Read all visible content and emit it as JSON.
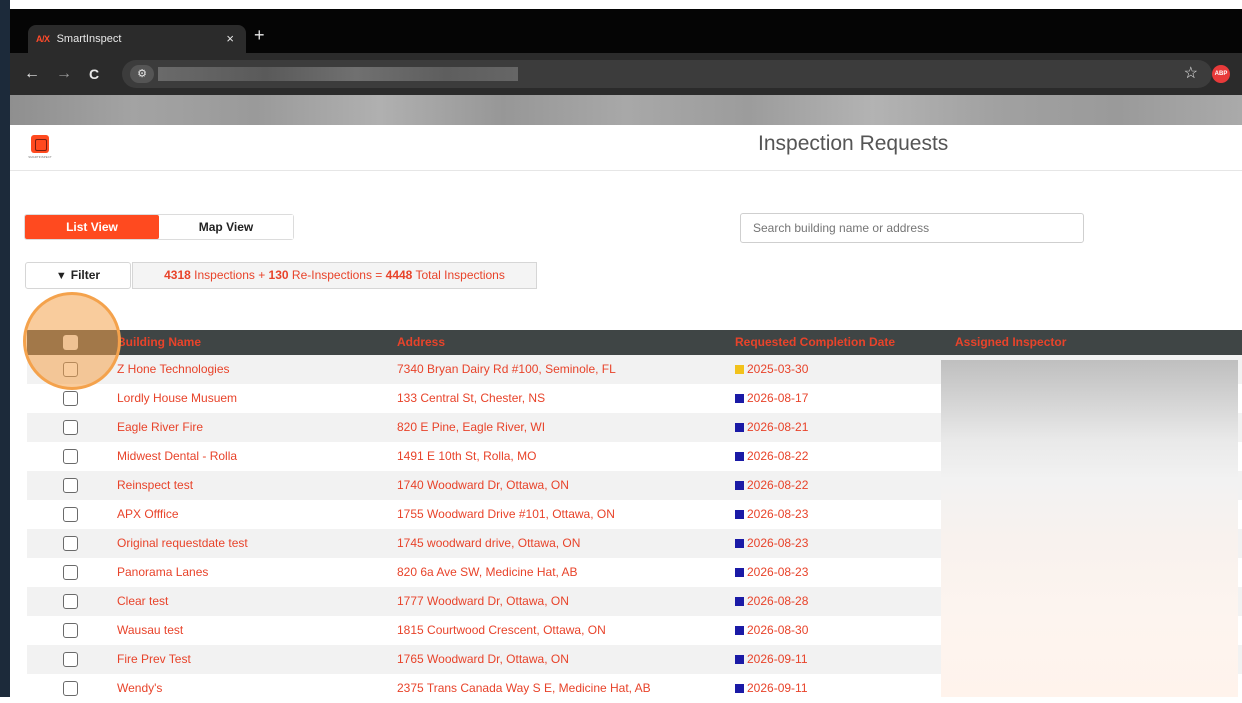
{
  "browser": {
    "tab_logo": "A/X",
    "tab_title": "SmartInspect",
    "tab_close": "×",
    "new_tab": "+",
    "back_icon": "←",
    "forward_icon": "→",
    "reload_icon": "C",
    "site_icon": "⚙",
    "bookmark_star": "☆",
    "extension_label": "ABP"
  },
  "header": {
    "title": "Inspection Requests",
    "logo_tagline": "SMARTINSPECT"
  },
  "view_toggle": {
    "list_label": "List View",
    "map_label": "Map View",
    "active": "List View"
  },
  "search": {
    "placeholder": "Search building name or address"
  },
  "filter": {
    "label": "Filter",
    "icon": "funnel-icon"
  },
  "counts": {
    "inspections": "4318",
    "inspections_text": " Inspections + ",
    "reinspections": "130",
    "reinspections_text": " Re-Inspections = ",
    "total": "4448",
    "total_text": " Total Inspections"
  },
  "table": {
    "columns": [
      "Building Name",
      "Address",
      "Requested Completion Date",
      "Assigned Inspector"
    ],
    "rows": [
      {
        "name": "Z Hone Technologies",
        "address": "7340 Bryan Dairy Rd #100, Seminole, FL",
        "date": "2025-03-30",
        "status_color": "#f2c21b"
      },
      {
        "name": "Lordly House Musuem",
        "address": "133 Central St, Chester, NS",
        "date": "2026-08-17",
        "status_color": "#1a1aa6"
      },
      {
        "name": "Eagle River Fire",
        "address": "820 E Pine, Eagle River, WI",
        "date": "2026-08-21",
        "status_color": "#1a1aa6"
      },
      {
        "name": "Midwest Dental - Rolla",
        "address": "1491 E 10th St, Rolla, MO",
        "date": "2026-08-22",
        "status_color": "#1a1aa6"
      },
      {
        "name": "Reinspect test",
        "address": "1740 Woodward Dr, Ottawa, ON",
        "date": "2026-08-22",
        "status_color": "#1a1aa6"
      },
      {
        "name": "APX Offfice",
        "address": "1755 Woodward Drive #101, Ottawa, ON",
        "date": "2026-08-23",
        "status_color": "#1a1aa6"
      },
      {
        "name": "Original requestdate test",
        "address": "1745 woodward drive, Ottawa, ON",
        "date": "2026-08-23",
        "status_color": "#1a1aa6"
      },
      {
        "name": "Panorama Lanes",
        "address": "820 6a Ave SW, Medicine Hat, AB",
        "date": "2026-08-23",
        "status_color": "#1a1aa6"
      },
      {
        "name": "Clear test",
        "address": "1777 Woodward Dr, Ottawa, ON",
        "date": "2026-08-28",
        "status_color": "#1a1aa6"
      },
      {
        "name": "Wausau test",
        "address": "1815 Courtwood Crescent, Ottawa, ON",
        "date": "2026-08-30",
        "status_color": "#1a1aa6"
      },
      {
        "name": "Fire Prev Test",
        "address": "1765 Woodward Dr, Ottawa, ON",
        "date": "2026-09-11",
        "status_color": "#1a1aa6"
      },
      {
        "name": "Wendy's",
        "address": "2375 Trans Canada Way S E, Medicine Hat, AB",
        "date": "2026-09-11",
        "status_color": "#1a1aa6"
      }
    ]
  },
  "colors": {
    "accent": "#ff4a1f",
    "link_text": "#e8432a",
    "header_bg": "#3f4545"
  }
}
